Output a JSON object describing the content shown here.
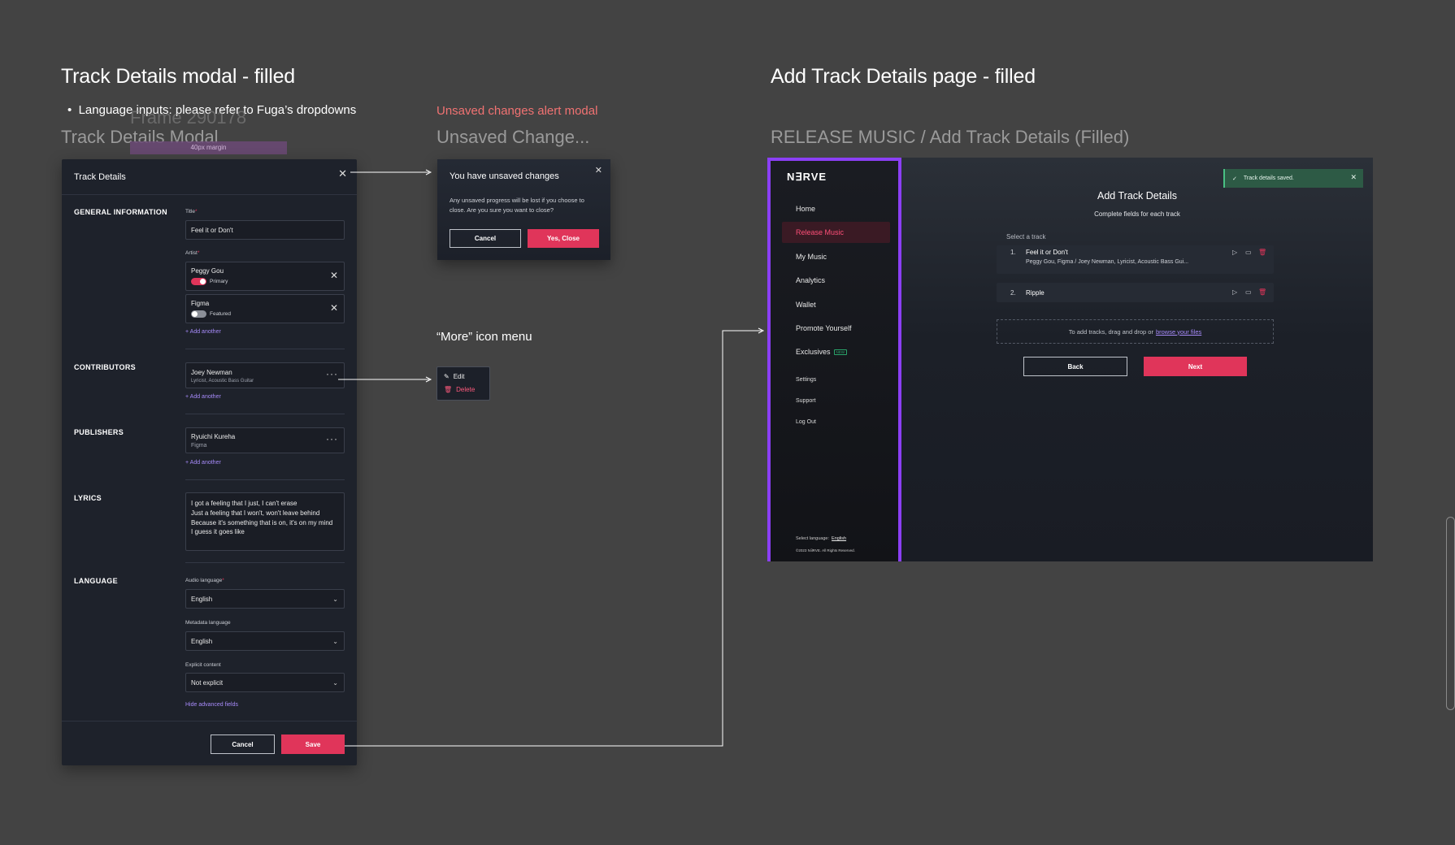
{
  "left_section": {
    "title": "Track Details modal - filled",
    "bullet": "Language inputs: please refer to Fuga’s dropdowns",
    "ghost_frame": "Frame 290178",
    "margin_tag": "40px margin",
    "frame_label": "Track Details Modal"
  },
  "modal": {
    "title": "Track Details",
    "close_icon": "close-icon",
    "general": {
      "label": "GENERAL INFORMATION",
      "title_label": "Title",
      "title_value": "Feel it or Don't",
      "artist_label": "Artist",
      "artists": [
        {
          "name": "Peggy Gou",
          "role": "Primary",
          "toggle": "on"
        },
        {
          "name": "Figma",
          "role": "Featured",
          "toggle": "off"
        }
      ],
      "add_another": "+ Add another"
    },
    "contributors": {
      "label": "CONTRIBUTORS",
      "name": "Joey Newman",
      "roles": "Lyricist, Acoustic Bass Guitar",
      "add_another": "+ Add another"
    },
    "publishers": {
      "label": "PUBLISHERS",
      "name": "Ryuichi Kureha",
      "sub": "Figma",
      "add_another": "+ Add another"
    },
    "lyrics": {
      "label": "LYRICS",
      "text": "I got a feeling that I just, I can't erase\nJust a feeling that I won't, won't leave behind\nBecause it's something that is on, it's on my mind\nI guess it goes like"
    },
    "language": {
      "label": "LANGUAGE",
      "audio_label": "Audio language",
      "audio_value": "English",
      "metadata_label": "Metadata language",
      "metadata_value": "English",
      "explicit_label": "Explicit content",
      "explicit_value": "Not explicit",
      "hide_link": "Hide advanced fields"
    },
    "footer": {
      "cancel": "Cancel",
      "save": "Save"
    }
  },
  "unsaved": {
    "section_label": "Unsaved changes alert modal",
    "frame_label": "Unsaved Change...",
    "title": "You have unsaved changes",
    "body": "Any unsaved progress will be lost if you choose to close. Are you sure you want to close?",
    "cancel": "Cancel",
    "confirm": "Yes, Close"
  },
  "more_menu": {
    "section_label": "“More” icon menu",
    "edit": "Edit",
    "delete": "Delete"
  },
  "right_section": {
    "title": "Add Track Details page - filled",
    "frame_label": "RELEASE MUSIC / Add Track Details (Filled)"
  },
  "page": {
    "logo": "N∃RVE",
    "nav": [
      "Home",
      "Release Music",
      "My Music",
      "Analytics",
      "Wallet",
      "Promote Yourself",
      "Exclusives"
    ],
    "exclusives_badge": "NEW",
    "nav_small": [
      "Settings",
      "Support",
      "Log Out"
    ],
    "select_language_label": "Select language:",
    "select_language_value": "English",
    "copyright": "©2023 N∃RVE. All Rights Reserved.",
    "toast": "Track details saved.",
    "heading": "Add Track Details",
    "subheading": "Complete fields for each track",
    "select_track": "Select a track",
    "tracks": [
      {
        "num": "1.",
        "name": "Feel it or Don't",
        "meta": "Peggy Gou, Figma / Joey Newman, Lyricist, Acoustic Bass Gui..."
      },
      {
        "num": "2.",
        "name": "Ripple",
        "meta": ""
      }
    ],
    "drop_text": "To add tracks, drag and drop or",
    "drop_link": "browse your files",
    "back": "Back",
    "next": "Next"
  },
  "colors": {
    "canvas": "#434343",
    "accent_red": "#e0355a",
    "accent_purple": "#8b3ff5",
    "link_purple": "#a78bfa",
    "toast_green": "#2d5a45"
  }
}
